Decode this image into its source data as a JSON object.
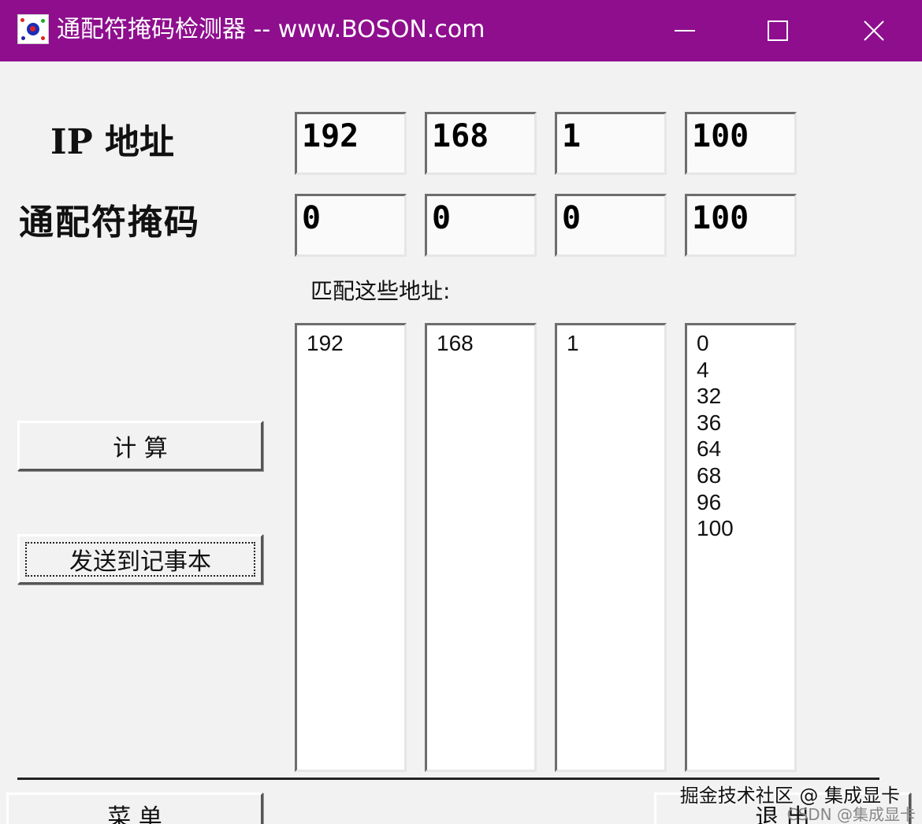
{
  "window": {
    "title": "通配符掩码检测器  -- www.BOSON.com",
    "controls": {
      "minimize": "—",
      "maximize": "☐",
      "close": "✕"
    },
    "titlebar_color": "#8e0e8e"
  },
  "labels": {
    "ip_address": "IP 地址",
    "wildcard_mask": "通配符掩码",
    "matches": "匹配这些地址:"
  },
  "ip": [
    "192",
    "168",
    "1",
    "100"
  ],
  "mask": [
    "0",
    "0",
    "0",
    "100"
  ],
  "results": [
    [
      "192"
    ],
    [
      "168"
    ],
    [
      "1"
    ],
    [
      "0",
      "4",
      "32",
      "36",
      "64",
      "68",
      "96",
      "100"
    ]
  ],
  "buttons": {
    "calculate": "计  算",
    "send_to_notepad": "发送到记事本",
    "menu": "菜  单",
    "exit": "退  出"
  },
  "watermark": {
    "primary": "掘金技术社区 @ 集成显卡",
    "secondary": "CSDN @集成显卡"
  }
}
